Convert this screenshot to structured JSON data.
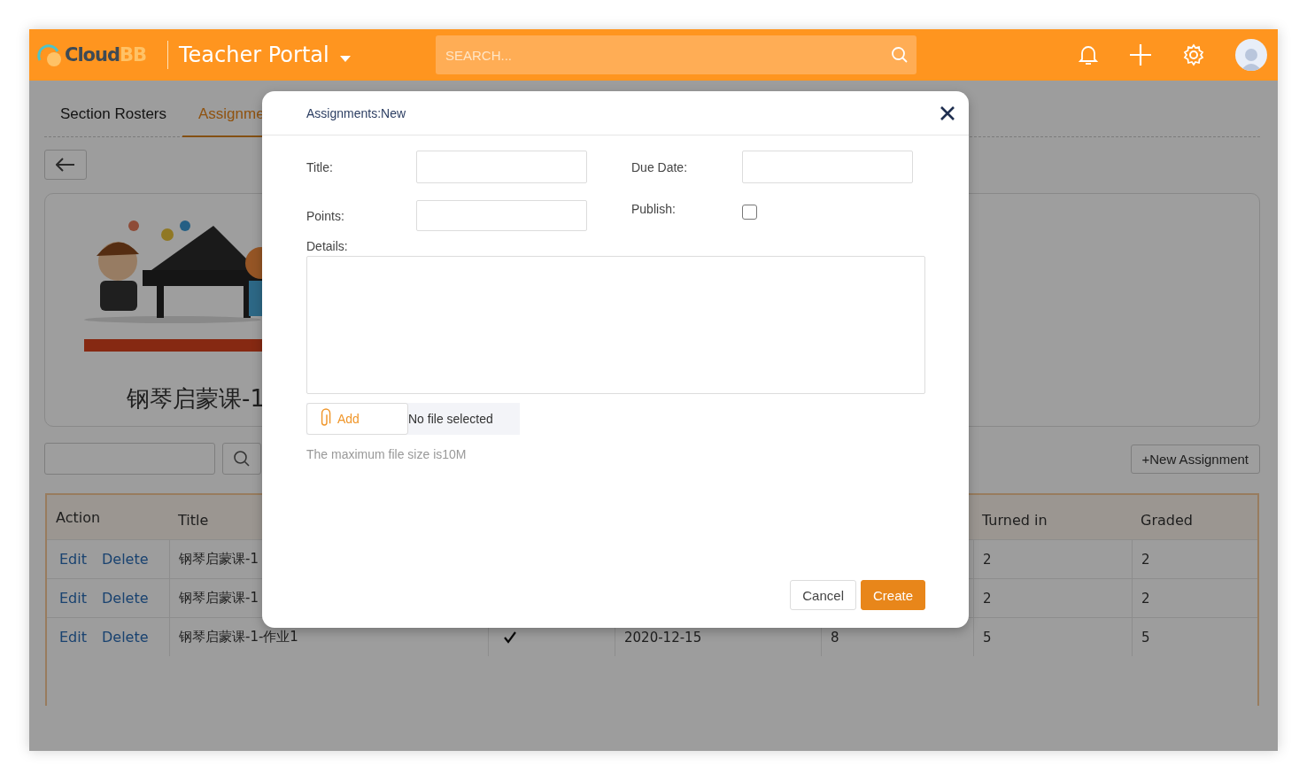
{
  "header": {
    "logo": {
      "main": "Cloud",
      "accent": "BB"
    },
    "portal": "Teacher Portal",
    "search": {
      "placeholder": "SEARCH..."
    }
  },
  "tabs": [
    {
      "label": "Section Rosters",
      "selected": false
    },
    {
      "label": "Assignme",
      "selected": true
    }
  ],
  "course": {
    "title": "钢琴启蒙课-1"
  },
  "toolbar": {
    "new_button": "+New Assignment"
  },
  "table": {
    "headers": {
      "action": "Action",
      "title": "Title",
      "turned_in": "Turned in",
      "graded": "Graded"
    },
    "rows": [
      {
        "actions": [
          "Edit",
          "Delete"
        ],
        "title": "钢琴启蒙课-1",
        "turned_in": "2",
        "graded": "2"
      },
      {
        "actions": [
          "Edit",
          "Delete"
        ],
        "title": "钢琴启蒙课-1",
        "turned_in": "2",
        "graded": "2"
      },
      {
        "actions": [
          "Edit",
          "Delete"
        ],
        "title": "钢琴启蒙课-1-作业1",
        "column_3": {
          "checked": true
        },
        "column_4": "2020-12-15",
        "column_5": "8",
        "turned_in": "5",
        "graded": "5"
      }
    ]
  },
  "modal": {
    "title": "Assignments:New",
    "fields": [
      {
        "kind": "text",
        "label": "Title:"
      },
      {
        "kind": "text",
        "label": "Due Date:"
      },
      {
        "kind": "text",
        "label": "Points:"
      },
      {
        "kind": "checkbox",
        "label": "Publish:",
        "checked": false
      },
      {
        "kind": "textarea",
        "label": "Details:"
      }
    ],
    "upload": {
      "button": "Add",
      "status": "No file selected",
      "hint": "The maximum file size is10M"
    },
    "buttons": [
      {
        "label": "Cancel",
        "kind": "secondary"
      },
      {
        "label": "Create",
        "kind": "primary"
      }
    ]
  }
}
